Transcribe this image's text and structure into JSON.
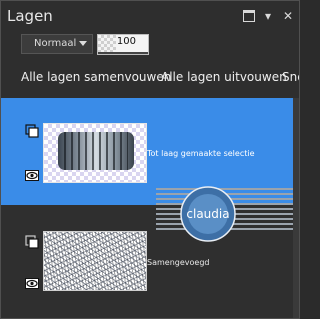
{
  "window": {
    "title": "Lagen"
  },
  "titlebar_buttons": {
    "maximize_icon": "maximize-icon",
    "menu_glyph": "▾",
    "close_glyph": "✕"
  },
  "toolbar": {
    "blend_mode": "Normaal",
    "opacity_value": "100",
    "opacity_fraction": 1.0
  },
  "actions": [
    {
      "label": "Alle lagen samenvouwen"
    },
    {
      "label": "Alle lagen uitvouwen"
    },
    {
      "label": "Sne"
    }
  ],
  "layers": [
    {
      "name": "Tot laag gemaakte selectie",
      "selected": true,
      "visible": true
    },
    {
      "name": "Samengevoegd",
      "selected": false,
      "visible": true
    }
  ],
  "watermark": {
    "text": "claudia"
  },
  "colors": {
    "selection": "#3a8ce8",
    "panel_bg": "#2e2e2e"
  }
}
